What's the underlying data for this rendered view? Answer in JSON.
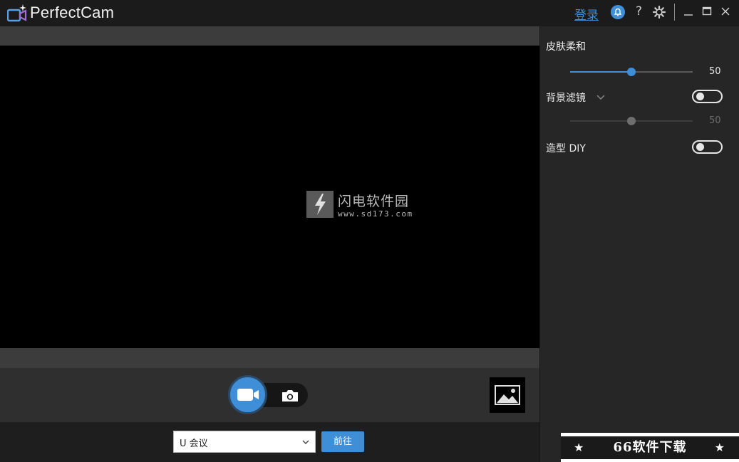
{
  "titlebar": {
    "app_title": "PerfectCam",
    "login_label": "登录",
    "help_label": "?",
    "accent": "#3f8fd8"
  },
  "preview": {
    "watermark_name": "闪电软件园",
    "watermark_url": "www.sd173.com"
  },
  "controls": {
    "video_mode_icon": "video-camera-icon",
    "photo_mode_icon": "camera-icon",
    "gallery_icon": "image-icon"
  },
  "bottombar": {
    "meeting_select_value": "U 会议",
    "go_label": "前往"
  },
  "panel": {
    "skin_smoothing": {
      "label": "皮肤柔和",
      "value": "50",
      "level": 50
    },
    "background_filter": {
      "label": "背景滤镜",
      "value": "50",
      "level": 50,
      "enabled": false
    },
    "style_diy": {
      "label": "造型 DIY",
      "enabled": false
    }
  },
  "banner": {
    "text": "66软件下载",
    "star": "★"
  }
}
